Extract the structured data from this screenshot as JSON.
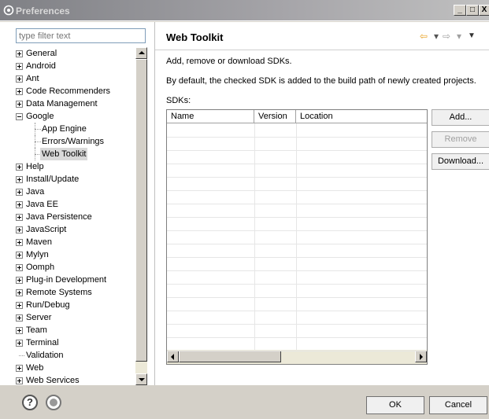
{
  "window": {
    "title": "Preferences",
    "minimize": "_",
    "maximize": "□",
    "close": "X"
  },
  "filter": {
    "placeholder": "type filter text"
  },
  "tree": {
    "items": [
      {
        "label": "General",
        "expander": "plus"
      },
      {
        "label": "Android",
        "expander": "plus"
      },
      {
        "label": "Ant",
        "expander": "plus"
      },
      {
        "label": "Code Recommenders",
        "expander": "plus"
      },
      {
        "label": "Data Management",
        "expander": "plus"
      },
      {
        "label": "Google",
        "expander": "minus"
      },
      {
        "label": "App Engine",
        "child": true
      },
      {
        "label": "Errors/Warnings",
        "child": true
      },
      {
        "label": "Web Toolkit",
        "child": true,
        "selected": true
      },
      {
        "label": "Help",
        "expander": "plus"
      },
      {
        "label": "Install/Update",
        "expander": "plus"
      },
      {
        "label": "Java",
        "expander": "plus"
      },
      {
        "label": "Java EE",
        "expander": "plus"
      },
      {
        "label": "Java Persistence",
        "expander": "plus"
      },
      {
        "label": "JavaScript",
        "expander": "plus"
      },
      {
        "label": "Maven",
        "expander": "plus"
      },
      {
        "label": "Mylyn",
        "expander": "plus"
      },
      {
        "label": "Oomph",
        "expander": "plus"
      },
      {
        "label": "Plug-in Development",
        "expander": "plus"
      },
      {
        "label": "Remote Systems",
        "expander": "plus"
      },
      {
        "label": "Run/Debug",
        "expander": "plus"
      },
      {
        "label": "Server",
        "expander": "plus"
      },
      {
        "label": "Team",
        "expander": "plus"
      },
      {
        "label": "Terminal",
        "expander": "plus"
      },
      {
        "label": "Validation",
        "expander": "none"
      },
      {
        "label": "Web",
        "expander": "plus"
      },
      {
        "label": "Web Services",
        "expander": "plus"
      }
    ]
  },
  "page": {
    "title": "Web Toolkit",
    "description": "Add, remove or download SDKs.",
    "note": "By default, the checked SDK is added to the build path of newly created projects.",
    "sdks_label": "SDKs:",
    "nav": {
      "back_icon": "⇦",
      "back_menu_icon": "▾",
      "forward_icon": "⇨",
      "forward_menu_icon": "▾",
      "view_menu_icon": "▼"
    }
  },
  "sdk_table": {
    "columns": [
      "Name",
      "Version",
      "Location"
    ],
    "rows": []
  },
  "buttons": {
    "add": "Add...",
    "remove": "Remove",
    "download": "Download..."
  },
  "footer": {
    "help_icon": "?",
    "ok": "OK",
    "cancel": "Cancel"
  },
  "colors": {
    "nav_back": "#e8a020",
    "nav_disabled": "#a0a0a0"
  }
}
